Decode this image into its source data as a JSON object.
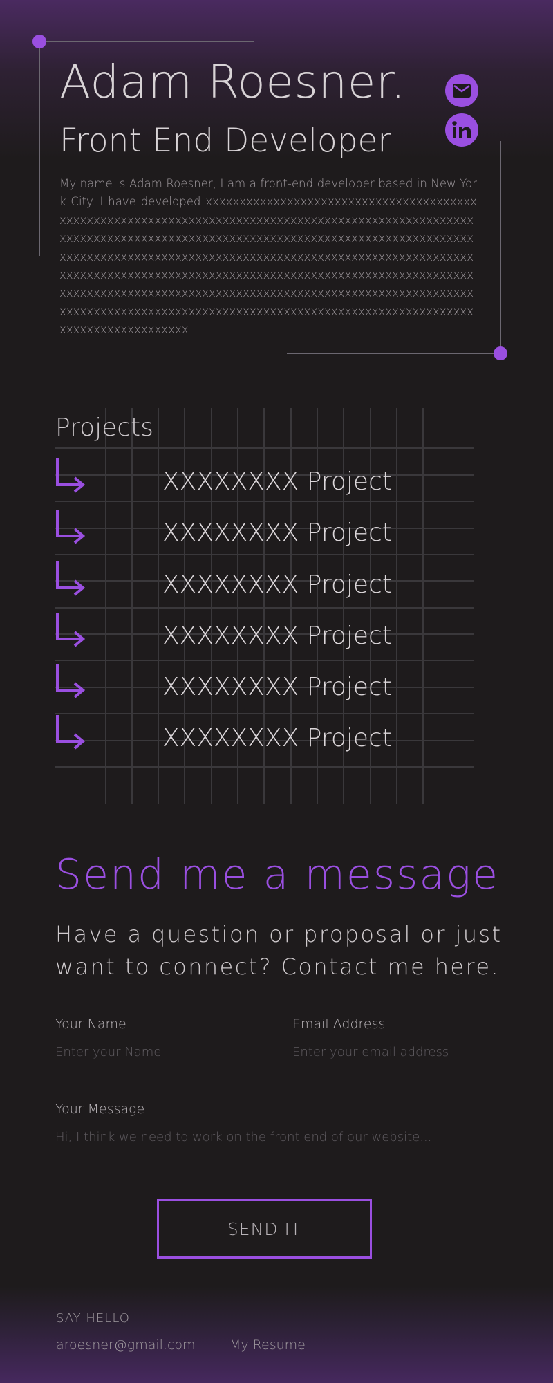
{
  "hero": {
    "name": "Adam Roesner.",
    "role": "Front End Developer",
    "bio": "My name is Adam Roesner, I am a front-end developer based in New York City. I have developed xxxxxxxxxxxxxxxxxxxxxxxxxxxxxxxxxxxxxxxxxxxxxxxxxxxxxxxxxxxxxxxxxxxxxxxxxxxxxxxxxxxxxxxxxxxxxxxxxxxxxxxxxxxxxxxxxxxxxxxxxxxxxxxxxxxxxxxxxxxxxxxxxxxxxxxxxxxxxxxxxxxxxxxxxxxxxxxxxxxxxxxxxxxxxxxxxxxxxxxxxxxxxxxxxxxxxxxxxxxxxxxxxxxxxxxxxxxxxxxxxxxxxxxxxxxxxxxxxxxxxxxxxxxxxxxxxxxxxxxxxxxxxxxxxxxxxxxxxxxxxxxxxxxxxxxxxxxxxxxxxxxxxxxxxxxxxxxxxxxxxxxxxxxxxxxxxxxxxxxxxxxxxxxxxxxxxxxxxxxxxxxxxxxxxxxxxxxxxxxxxxxxxxxxxxxxxxxxxxxxxxxxx",
    "social": [
      {
        "icon": "mail-icon"
      },
      {
        "icon": "linkedin-icon"
      }
    ]
  },
  "projects": {
    "title": "Projects",
    "items": [
      {
        "label": "XXXXXXXX Project"
      },
      {
        "label": "XXXXXXXX Project"
      },
      {
        "label": "XXXXXXXX Project"
      },
      {
        "label": "XXXXXXXX Project"
      },
      {
        "label": "XXXXXXXX Project"
      },
      {
        "label": "XXXXXXXX Project"
      }
    ]
  },
  "contact": {
    "title": "Send me a message",
    "subtitle": "Have a question or proposal or just want to connect? Contact me here.",
    "name_label": "Your Name",
    "name_placeholder": "Enter your Name",
    "email_label": "Email Address",
    "email_placeholder": "Enter your email address",
    "message_label": "Your Message",
    "message_placeholder": "Hi, I think we need to work on the front end of our website...",
    "send_label": "SEND IT"
  },
  "footer": {
    "label": "SAY HELLO",
    "email": "aroesner@gmail.com",
    "resume": "My Resume"
  },
  "colors": {
    "accent": "#9a4fe0",
    "background": "#1e1b1c",
    "header_gradient": "#4a2a60"
  }
}
